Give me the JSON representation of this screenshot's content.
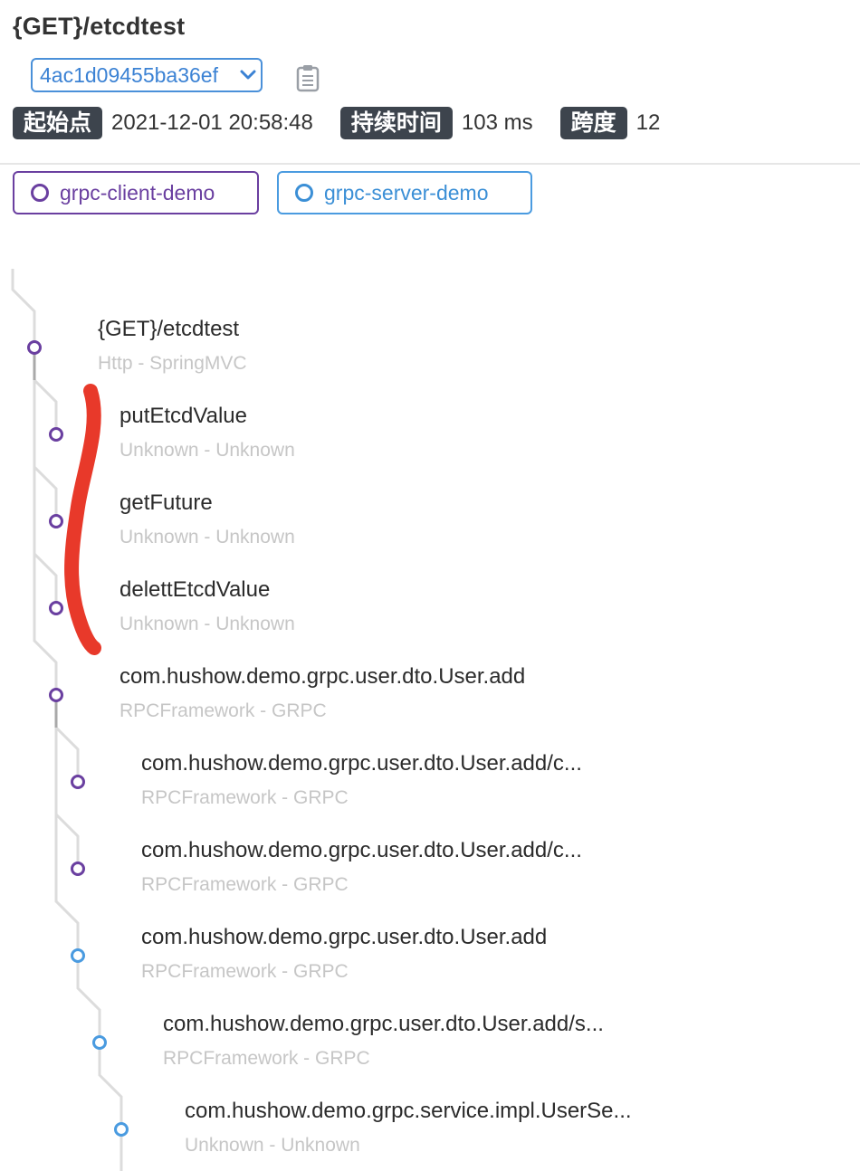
{
  "header": {
    "title": "{GET}/etcdtest",
    "trace_id": "4ac1d09455ba36ef",
    "start_label": "起始点",
    "start_value": "2021-12-01 20:58:48",
    "duration_label": "持续时间",
    "duration_value": "103 ms",
    "span_label": "跨度",
    "span_value": "12"
  },
  "services": [
    {
      "name": "grpc-client-demo",
      "color": "#6a3fa0"
    },
    {
      "name": "grpc-server-demo",
      "color": "#4a9be0"
    }
  ],
  "spans": [
    {
      "title": "{GET}/etcdtest",
      "sub": "Http - SpringMVC",
      "service": "grpc-client-demo"
    },
    {
      "title": "putEtcdValue",
      "sub": "Unknown - Unknown",
      "service": "grpc-client-demo"
    },
    {
      "title": "getFuture",
      "sub": "Unknown - Unknown",
      "service": "grpc-client-demo"
    },
    {
      "title": "delettEtcdValue",
      "sub": "Unknown - Unknown",
      "service": "grpc-client-demo"
    },
    {
      "title": "com.hushow.demo.grpc.user.dto.User.add",
      "sub": "RPCFramework - GRPC",
      "service": "grpc-client-demo"
    },
    {
      "title": "com.hushow.demo.grpc.user.dto.User.add/c...",
      "sub": "RPCFramework - GRPC",
      "service": "grpc-client-demo"
    },
    {
      "title": "com.hushow.demo.grpc.user.dto.User.add/c...",
      "sub": "RPCFramework - GRPC",
      "service": "grpc-client-demo"
    },
    {
      "title": "com.hushow.demo.grpc.user.dto.User.add",
      "sub": "RPCFramework - GRPC",
      "service": "grpc-server-demo"
    },
    {
      "title": "com.hushow.demo.grpc.user.dto.User.add/s...",
      "sub": "RPCFramework - GRPC",
      "service": "grpc-server-demo"
    },
    {
      "title": "com.hushow.demo.grpc.service.impl.UserSe...",
      "sub": "Unknown - Unknown",
      "service": "grpc-server-demo"
    }
  ],
  "icons": {
    "dropdown": "chevron-down-icon",
    "copy": "clipboard-icon",
    "service_marker": "ring-icon"
  },
  "colors": {
    "client": "#6a3fa0",
    "server": "#4a9be0",
    "annotation": "#e8392a",
    "tag_bg": "#3d444d"
  }
}
